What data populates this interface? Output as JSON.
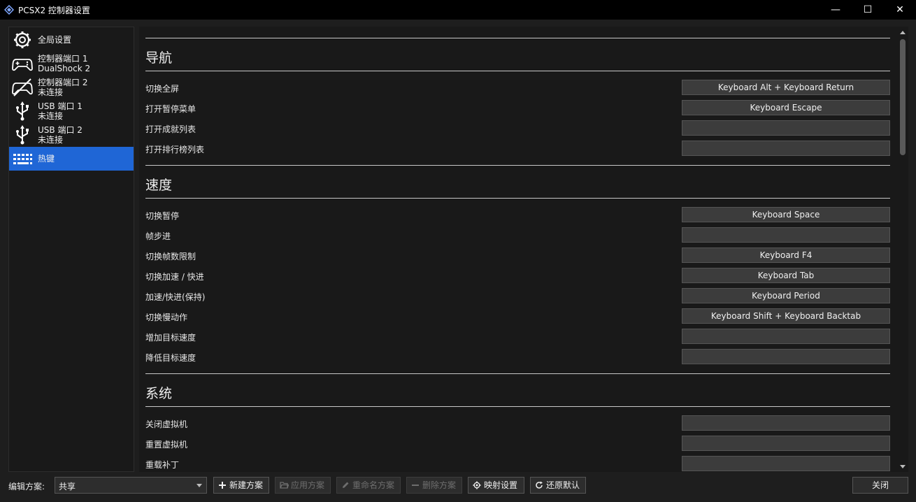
{
  "window": {
    "title": "PCSX2 控制器设置",
    "minimize_glyph": "—",
    "maximize_glyph": "☐",
    "close_glyph": "✕"
  },
  "sidebar": {
    "items": [
      {
        "label": "全局设置",
        "sublabel": "",
        "icon": "gear-icon",
        "active": false
      },
      {
        "label": "控制器端口 1",
        "sublabel": "DualShock 2",
        "icon": "gamepad-icon",
        "active": false
      },
      {
        "label": "控制器端口 2",
        "sublabel": "未连接",
        "icon": "gamepad-disconnected-icon",
        "active": false
      },
      {
        "label": "USB 端口 1",
        "sublabel": "未连接",
        "icon": "usb-icon",
        "active": false
      },
      {
        "label": "USB 端口 2",
        "sublabel": "未连接",
        "icon": "usb-icon",
        "active": false
      },
      {
        "label": "热键",
        "sublabel": "",
        "icon": "keyboard-icon",
        "active": true
      }
    ]
  },
  "sections": [
    {
      "title": "导航",
      "rows": [
        {
          "label": "切换全屏",
          "binding": "Keyboard Alt + Keyboard Return"
        },
        {
          "label": "打开暂停菜单",
          "binding": "Keyboard Escape"
        },
        {
          "label": "打开成就列表",
          "binding": ""
        },
        {
          "label": "打开排行榜列表",
          "binding": ""
        }
      ]
    },
    {
      "title": "速度",
      "rows": [
        {
          "label": "切换暂停",
          "binding": "Keyboard Space"
        },
        {
          "label": "帧步进",
          "binding": ""
        },
        {
          "label": "切换帧数限制",
          "binding": "Keyboard F4"
        },
        {
          "label": "切换加速 / 快进",
          "binding": "Keyboard Tab"
        },
        {
          "label": "加速/快进(保持)",
          "binding": "Keyboard Period"
        },
        {
          "label": "切换慢动作",
          "binding": "Keyboard Shift + Keyboard Backtab"
        },
        {
          "label": "增加目标速度",
          "binding": ""
        },
        {
          "label": "降低目标速度",
          "binding": ""
        }
      ]
    },
    {
      "title": "系统",
      "rows": [
        {
          "label": "关闭虚拟机",
          "binding": ""
        },
        {
          "label": "重置虚拟机",
          "binding": ""
        },
        {
          "label": "重载补丁",
          "binding": ""
        }
      ]
    }
  ],
  "bottom_bar": {
    "profile_label": "编辑方案:",
    "profile_value": "共享",
    "buttons": [
      {
        "label": "新建方案",
        "icon": "plus-icon",
        "enabled": true
      },
      {
        "label": "应用方案",
        "icon": "folder-open-icon",
        "enabled": false
      },
      {
        "label": "重命名方案",
        "icon": "pencil-icon",
        "enabled": false
      },
      {
        "label": "删除方案",
        "icon": "minus-icon",
        "enabled": false
      },
      {
        "label": "映射设置",
        "icon": "gear-icon",
        "enabled": true
      },
      {
        "label": "还原默认",
        "icon": "refresh-icon",
        "enabled": true
      }
    ],
    "close_label": "关闭"
  },
  "colors": {
    "accent": "#1f66d6",
    "background": "#1e1e1e",
    "panel": "#191919",
    "button": "#3c3c3c"
  }
}
